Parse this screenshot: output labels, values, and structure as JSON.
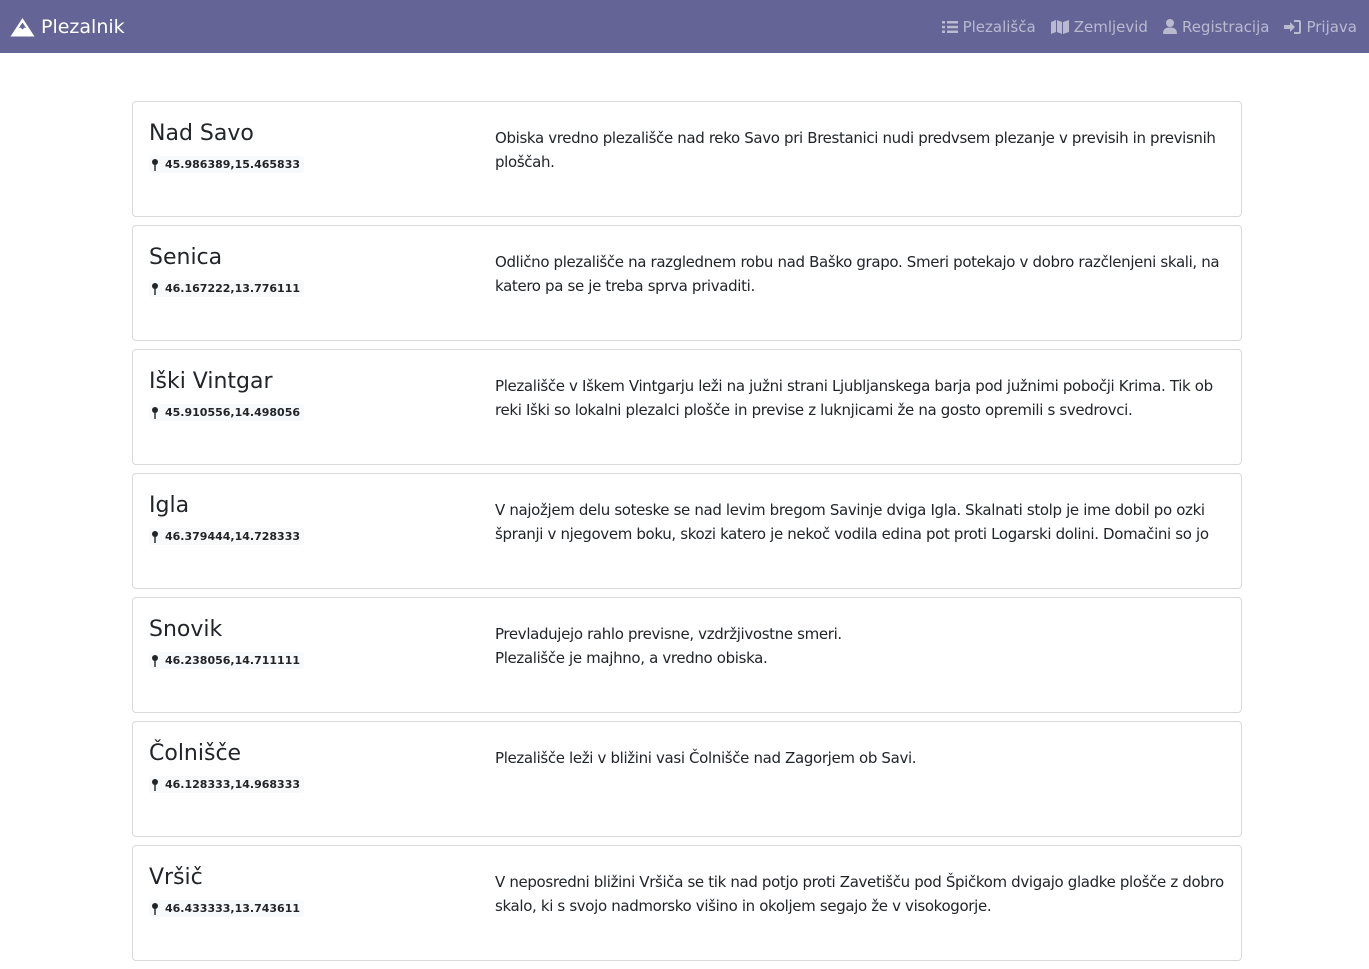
{
  "navbar": {
    "brand": "Plezalnik",
    "links": [
      {
        "label": "Plezališča",
        "icon": "list-icon"
      },
      {
        "label": "Zemljevid",
        "icon": "map-icon"
      },
      {
        "label": "Registracija",
        "icon": "user-icon"
      },
      {
        "label": "Prijava",
        "icon": "sign-in-icon"
      }
    ]
  },
  "crags": [
    {
      "name": "Nad Savo",
      "coords": "45.986389,15.465833",
      "desc": [
        "Obiska vredno plezališče nad reko Savo pri Brestanici nudi predvsem plezanje v previsih in previsnih",
        "ploščah."
      ]
    },
    {
      "name": "Senica",
      "coords": "46.167222,13.776111",
      "desc": [
        "Odlično plezališče na razglednem robu nad Baško grapo. Smeri potekajo v dobro razčlenjeni skali, na",
        "katero pa se je treba sprva privaditi."
      ]
    },
    {
      "name": "Iški Vintgar",
      "coords": "45.910556,14.498056",
      "desc": [
        "Plezališče v Iškem Vintgarju leži na južni strani Ljubljanskega barja pod južnimi pobočji Krima. Tik ob",
        "reki Iški so lokalni plezalci plošče in previse z luknjicami že na gosto opremili s svedrovci."
      ]
    },
    {
      "name": "Igla",
      "coords": "46.379444,14.728333",
      "desc": [
        "V najožjem delu soteske se nad levim bregom Savinje dviga Igla. Skalnati stolp je ime dobil po ozki",
        "špranji v njegovem boku, skozi katero je nekoč vodila edina pot proti Logarski dolini. Domačini so jo"
      ]
    },
    {
      "name": "Snovik",
      "coords": "46.238056,14.711111",
      "desc": [
        "Prevladujejo rahlo previsne, vzdržjivostne smeri.",
        "Plezališče je majhno, a vredno obiska."
      ]
    },
    {
      "name": "Čolnišče",
      "coords": "46.128333,14.968333",
      "desc": [
        "Plezališče leži v bližini vasi Čolnišče nad Zagorjem ob Savi.",
        ""
      ]
    },
    {
      "name": "Vršič",
      "coords": "46.433333,13.743611",
      "desc": [
        "V neposredni bližini Vršiča se tik nad potjo proti Zavetišču pod Špičkom dvigajo gladke plošče z dobro",
        "skalo, ki s svojo nadmorsko višino in okoljem segajo že v visokogorje."
      ]
    }
  ]
}
